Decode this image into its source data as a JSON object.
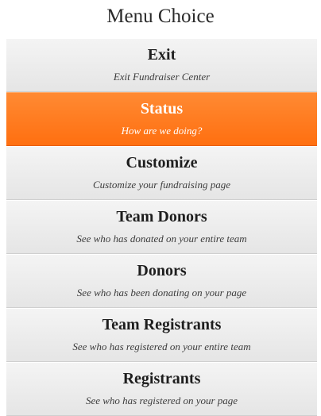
{
  "title": "Menu Choice",
  "accent_color": "#ff7a1f",
  "menu": {
    "items": [
      {
        "label": "Exit",
        "description": "Exit Fundraiser Center",
        "active": false
      },
      {
        "label": "Status",
        "description": "How are we doing?",
        "active": true
      },
      {
        "label": "Customize",
        "description": "Customize your fundraising page",
        "active": false
      },
      {
        "label": "Team Donors",
        "description": "See who has donated on your entire team",
        "active": false
      },
      {
        "label": "Donors",
        "description": "See who has been donating on your page",
        "active": false
      },
      {
        "label": "Team Registrants",
        "description": "See who has registered on your entire team",
        "active": false
      },
      {
        "label": "Registrants",
        "description": "See who has registered on your page",
        "active": false
      }
    ]
  }
}
